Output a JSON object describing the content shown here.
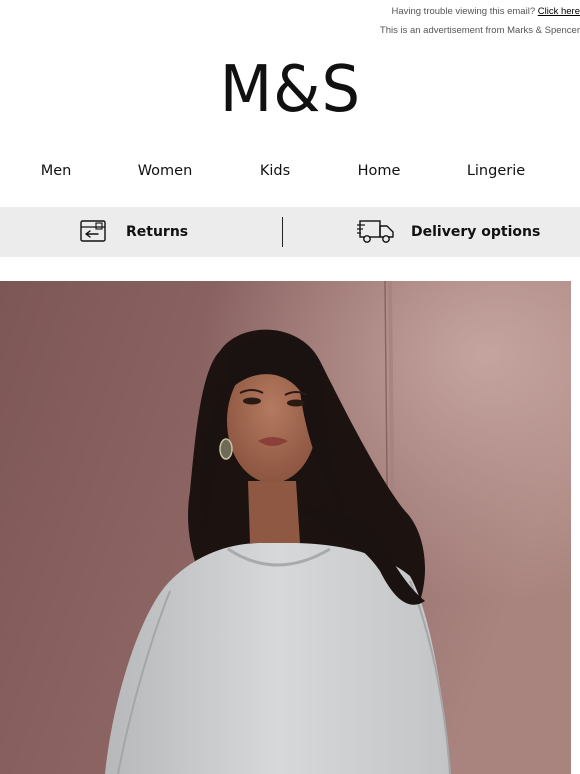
{
  "preheader": {
    "trouble_text": "Having trouble viewing this email? ",
    "click_here": "Click here",
    "advert_text": "This is an advertisement from Marks & Spencer"
  },
  "logo": {
    "text": "M&S"
  },
  "nav": {
    "items": [
      {
        "label": "Men"
      },
      {
        "label": "Women"
      },
      {
        "label": "Kids"
      },
      {
        "label": "Home"
      },
      {
        "label": "Lingerie"
      }
    ]
  },
  "services": {
    "returns": {
      "label": "Returns",
      "icon": "returns-card-icon"
    },
    "delivery": {
      "label": "Delivery options",
      "icon": "delivery-truck-icon"
    }
  },
  "hero": {
    "description_icon": "hero-photo",
    "colors": {
      "wall": "#8a6262",
      "wall_light": "#b28d8a",
      "top": "#cfd0d2",
      "hair": "#1a1210",
      "skin": "#a86b52"
    }
  },
  "theme": {
    "service_bar_bg": "#ececec",
    "text": "#111111"
  }
}
